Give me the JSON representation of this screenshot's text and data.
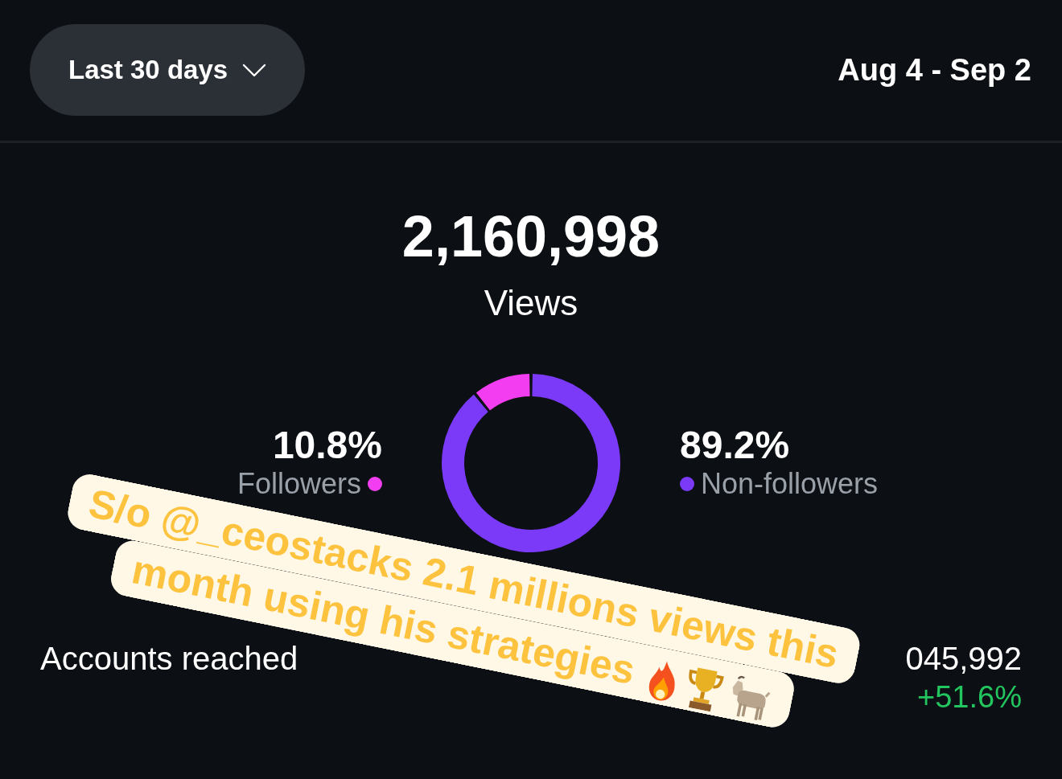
{
  "header": {
    "range_dropdown": {
      "label": "Last 30 days"
    },
    "date_range": "Aug 4 - Sep 2"
  },
  "views": {
    "total": "2,160,998",
    "label": "Views"
  },
  "audience": {
    "chart_data": {
      "type": "donut",
      "categories": [
        "Followers",
        "Non-followers"
      ],
      "values": [
        10.8,
        89.2
      ]
    },
    "legend": [
      {
        "percent": "10.8%",
        "color": "#f23ef0"
      },
      {
        "percent": "89.2%",
        "color": "#7a3af8"
      }
    ]
  },
  "accounts_reached": {
    "label": "Accounts reached",
    "value": "045,992",
    "change": "+51.6%"
  },
  "sticker": {
    "lines": [
      "S/o @_ceostacks 2.1 millions views this",
      "month using his strategies"
    ]
  }
}
